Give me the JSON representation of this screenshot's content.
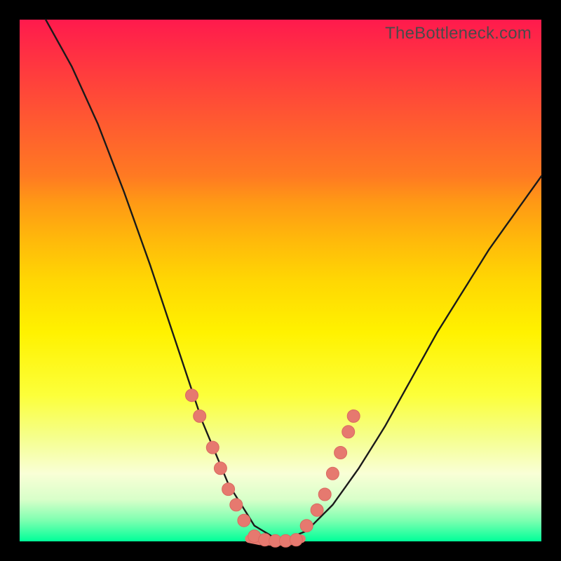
{
  "watermark": "TheBottleneck.com",
  "colors": {
    "frame": "#000000",
    "curve": "#1a1a1a",
    "marker_fill": "#e6796f",
    "marker_stroke": "#d96a60"
  },
  "chart_data": {
    "type": "line",
    "title": "",
    "xlabel": "",
    "ylabel": "",
    "xlim": [
      0,
      100
    ],
    "ylim": [
      0,
      100
    ],
    "grid": false,
    "legend_position": "none",
    "series": [
      {
        "name": "left-curve",
        "x": [
          5,
          10,
          15,
          20,
          25,
          30,
          35,
          40,
          45,
          50
        ],
        "values": [
          100,
          91,
          80,
          67,
          53,
          38,
          23,
          11,
          3,
          0
        ]
      },
      {
        "name": "right-curve",
        "x": [
          50,
          55,
          60,
          65,
          70,
          75,
          80,
          85,
          90,
          95,
          100
        ],
        "values": [
          0,
          2,
          7,
          14,
          22,
          31,
          40,
          48,
          56,
          63,
          70
        ]
      },
      {
        "name": "flat-bottom",
        "x": [
          44,
          46,
          48,
          50,
          52,
          54
        ],
        "values": [
          0.5,
          0.1,
          0.0,
          0.0,
          0.1,
          0.5
        ]
      }
    ],
    "markers": {
      "left": [
        {
          "x": 33,
          "y": 28
        },
        {
          "x": 34.5,
          "y": 24
        },
        {
          "x": 37,
          "y": 18
        },
        {
          "x": 38.5,
          "y": 14
        },
        {
          "x": 40,
          "y": 10
        },
        {
          "x": 41.5,
          "y": 7
        },
        {
          "x": 43,
          "y": 4
        }
      ],
      "right": [
        {
          "x": 55,
          "y": 3
        },
        {
          "x": 57,
          "y": 6
        },
        {
          "x": 58.5,
          "y": 9
        },
        {
          "x": 60,
          "y": 13
        },
        {
          "x": 61.5,
          "y": 17
        },
        {
          "x": 63,
          "y": 21
        },
        {
          "x": 64,
          "y": 24
        }
      ],
      "bottom": [
        {
          "x": 45,
          "y": 1
        },
        {
          "x": 47,
          "y": 0.3
        },
        {
          "x": 49,
          "y": 0.1
        },
        {
          "x": 51,
          "y": 0.1
        },
        {
          "x": 53,
          "y": 0.3
        }
      ]
    }
  }
}
